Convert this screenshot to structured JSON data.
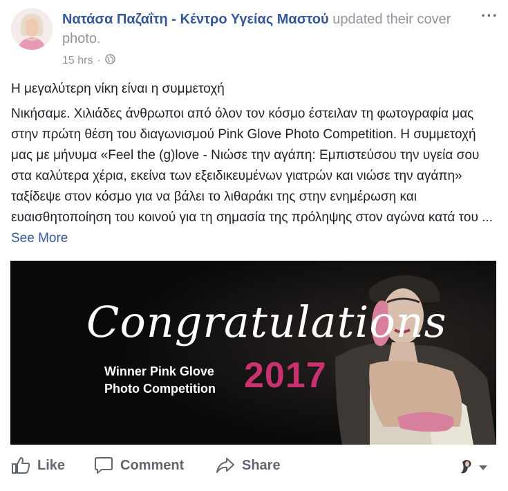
{
  "post": {
    "page_name": "Νατάσα Παζαΐτη - Κέντρο Υγείας Μαστού",
    "action_text": " updated their cover photo.",
    "timestamp": "15 hrs",
    "separator": "·",
    "privacy_icon": "globe-icon",
    "headline": "Η μεγαλύτερη νίκη είναι η συμμετοχή",
    "body": "Νικήσαμε. Χιλιάδες άνθρωποι από όλον τον κόσμο έστειλαν τη φωτογραφία μας στην πρώτη θέση του διαγωνισμού Pink Glove Photo Competition. Η συμμετοχή μας με μήνυμα «Feel the (g)love - Νιώσε την αγάπη: Εμπιστεύσου την υγεία σου στα καλύτερα χέρια, εκείνα των εξειδικευμένων γιατρών και νιώσε την αγάπη» ταξίδεψε στον κόσμο για να βάλει το λιθαράκι της στην ενημέρωση και ευαισθητοποίηση του κοινού για τη σημασία της πρόληψης στον αγώνα κατά του ...",
    "see_more": " See More"
  },
  "cover_image": {
    "title": "Congratulations",
    "line1": "Winner Pink Glove",
    "line2": "Photo Competition",
    "year": "2017",
    "year_color": "#c8326e"
  },
  "actions": {
    "like": "Like",
    "comment": "Comment",
    "share": "Share"
  },
  "colors": {
    "link": "#365899",
    "muted": "#90949c",
    "text": "#1d2129",
    "action": "#606770"
  }
}
